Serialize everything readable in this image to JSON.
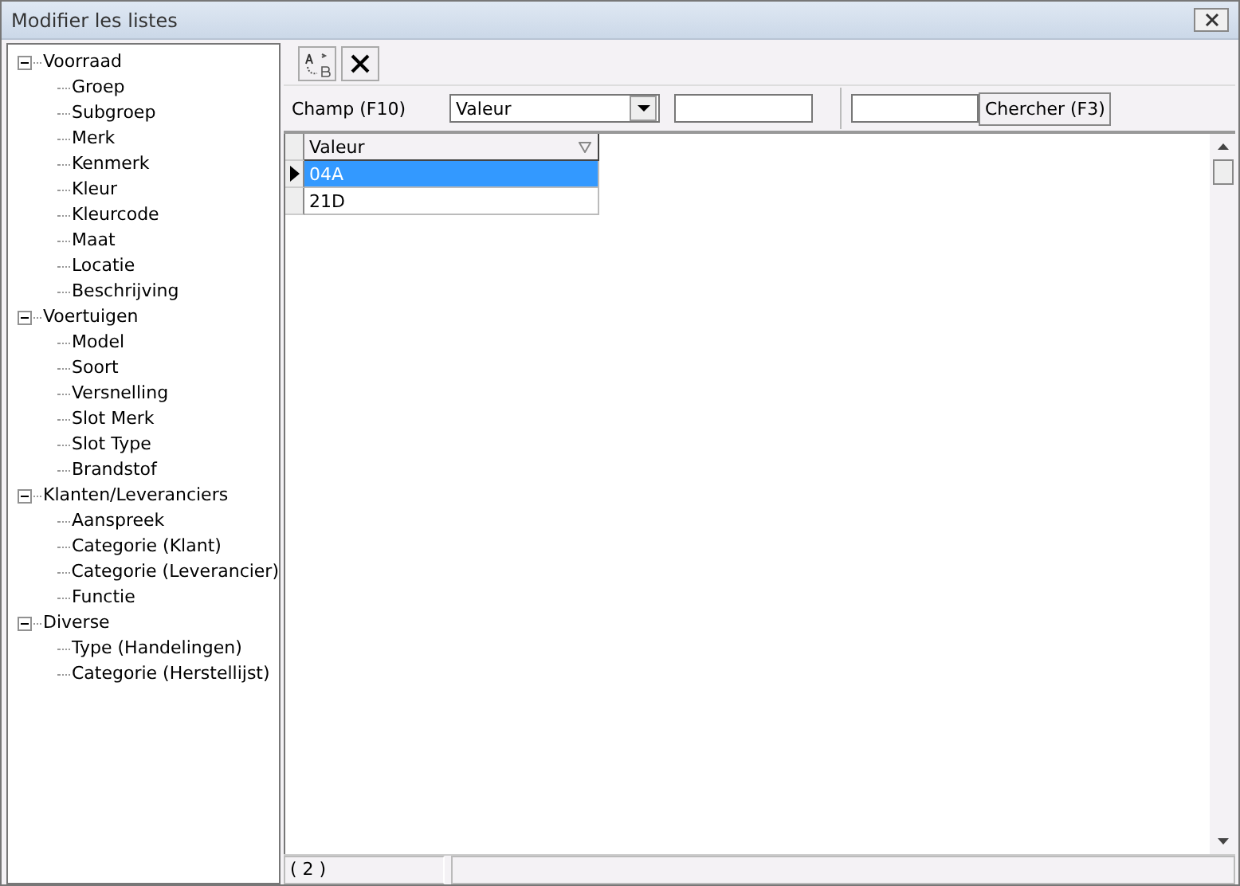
{
  "window": {
    "title": "Modifier les listes"
  },
  "tree": [
    {
      "label": "Voorraad",
      "expanded": true,
      "children": [
        {
          "label": "Groep"
        },
        {
          "label": "Subgroep"
        },
        {
          "label": "Merk"
        },
        {
          "label": "Kenmerk"
        },
        {
          "label": "Kleur"
        },
        {
          "label": "Kleurcode"
        },
        {
          "label": "Maat"
        },
        {
          "label": "Locatie"
        },
        {
          "label": "Beschrijving"
        }
      ]
    },
    {
      "label": "Voertuigen",
      "expanded": true,
      "children": [
        {
          "label": "Model"
        },
        {
          "label": "Soort"
        },
        {
          "label": "Versnelling"
        },
        {
          "label": "Slot Merk"
        },
        {
          "label": "Slot Type"
        },
        {
          "label": "Brandstof"
        }
      ]
    },
    {
      "label": "Klanten/Leveranciers",
      "expanded": true,
      "children": [
        {
          "label": "Aanspreek"
        },
        {
          "label": "Categorie (Klant)"
        },
        {
          "label": "Categorie (Leverancier)"
        },
        {
          "label": "Functie"
        }
      ]
    },
    {
      "label": "Diverse",
      "expanded": true,
      "children": [
        {
          "label": "Type (Handelingen)"
        },
        {
          "label": "Categorie (Herstellijst)"
        }
      ]
    }
  ],
  "filter": {
    "label": "Champ (F10)",
    "field": "Valeur",
    "search_button": "Chercher (F3)"
  },
  "grid": {
    "columns": [
      {
        "label": "Valeur"
      }
    ],
    "rows": [
      {
        "cells": [
          "04A"
        ],
        "selected": true
      },
      {
        "cells": [
          "21D"
        ],
        "selected": false
      }
    ]
  },
  "status_bar": {
    "count": "( 2 )"
  }
}
